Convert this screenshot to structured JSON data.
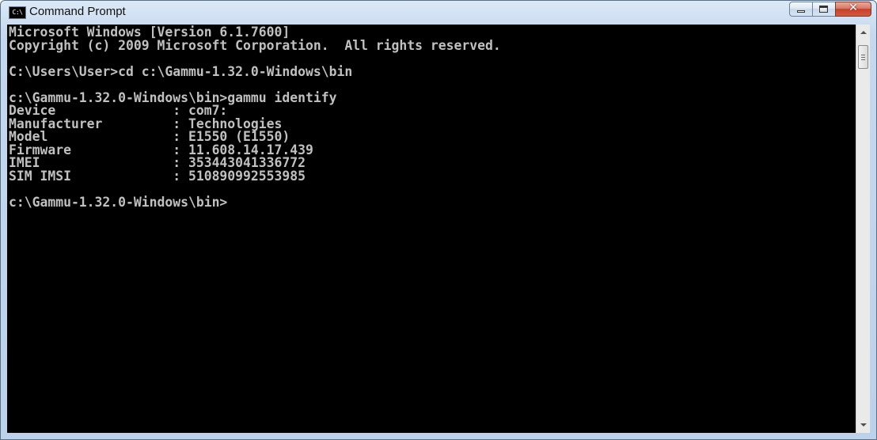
{
  "window": {
    "title": "Command Prompt",
    "icon": "cmd-icon",
    "icon_text": "C:\\",
    "controls": {
      "minimize_icon": "minimize-icon",
      "maximize_icon": "maximize-icon",
      "close_icon": "close-icon",
      "close_glyph": "✕"
    }
  },
  "console": {
    "lines": [
      "Microsoft Windows [Version 6.1.7600]",
      "Copyright (c) 2009 Microsoft Corporation.  All rights reserved.",
      "",
      "C:\\Users\\User>cd c:\\Gammu-1.32.0-Windows\\bin",
      "",
      "c:\\Gammu-1.32.0-Windows\\bin>gammu identify",
      "Device               : com7:",
      "Manufacturer         : Technologies",
      "Model                : E1550 (E1550)",
      "Firmware             : 11.608.14.17.439",
      "IMEI                 : 353443041336772",
      "SIM IMSI             : 510890992553985",
      "",
      "c:\\Gammu-1.32.0-Windows\\bin>"
    ]
  },
  "colors": {
    "console_background": "#000000",
    "console_text": "#c0c0c0",
    "close_button": "#c7402d",
    "frame": "#bcd2ea"
  }
}
